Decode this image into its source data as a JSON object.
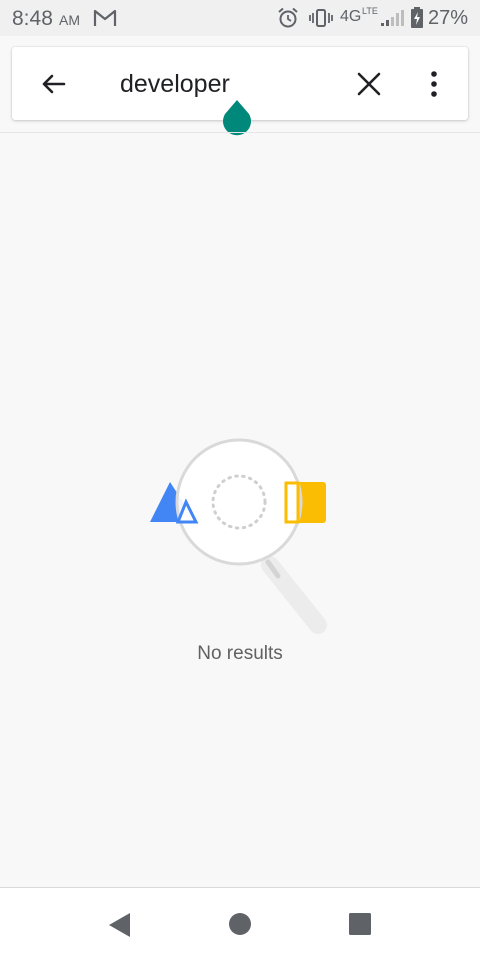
{
  "status_bar": {
    "time": "8:48",
    "ampm": "AM",
    "network": "4G",
    "network_sub": "LTE",
    "battery": "27%"
  },
  "search": {
    "query": "developer"
  },
  "empty_state": {
    "message": "No results"
  },
  "colors": {
    "cursor_handle": "#00897b",
    "blue_shape": "#4285f4",
    "yellow_shape": "#fbbc04"
  },
  "icons": {
    "back": "arrow-left-icon",
    "clear": "close-icon",
    "more": "more-vert-icon",
    "nav_back": "triangle-back-icon",
    "nav_home": "circle-home-icon",
    "nav_recents": "square-recents-icon"
  }
}
